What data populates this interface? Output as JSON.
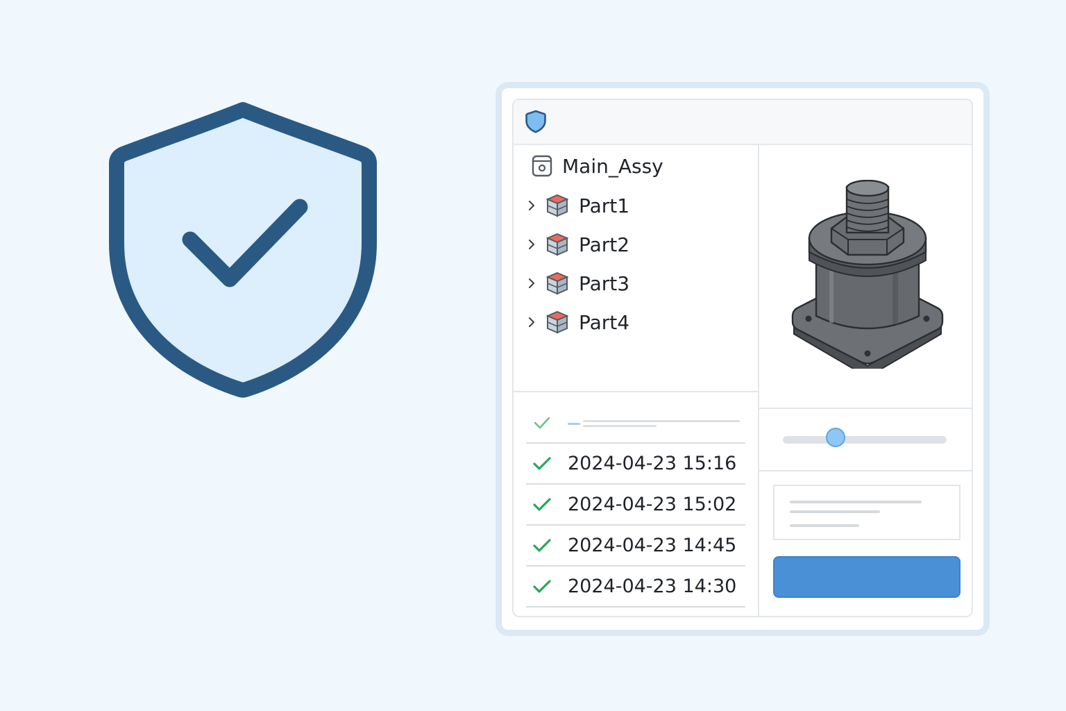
{
  "tree": {
    "root": {
      "label": "Main_Assy",
      "icon": "assembly-icon"
    },
    "items": [
      {
        "label": "Part1",
        "icon": "part-icon"
      },
      {
        "label": "Part2",
        "icon": "part-icon"
      },
      {
        "label": "Part3",
        "icon": "part-icon"
      },
      {
        "label": "Part4",
        "icon": "part-icon"
      }
    ]
  },
  "history": {
    "rows": [
      {
        "timestamp": "2024-04-23 15:16",
        "status": "check-icon"
      },
      {
        "timestamp": "2024-04-23 15:02",
        "status": "check-icon"
      },
      {
        "timestamp": "2024-04-23 14:45",
        "status": "check-icon"
      },
      {
        "timestamp": "2024-04-23 14:30",
        "status": "check-icon"
      }
    ]
  },
  "slider": {
    "value": 0.32
  },
  "colors": {
    "accent": "#4a90d6",
    "shield_stroke": "#2a5a84",
    "shield_fill": "#ddeefc",
    "success": "#2aa65a",
    "background": "#f0f8fd"
  }
}
